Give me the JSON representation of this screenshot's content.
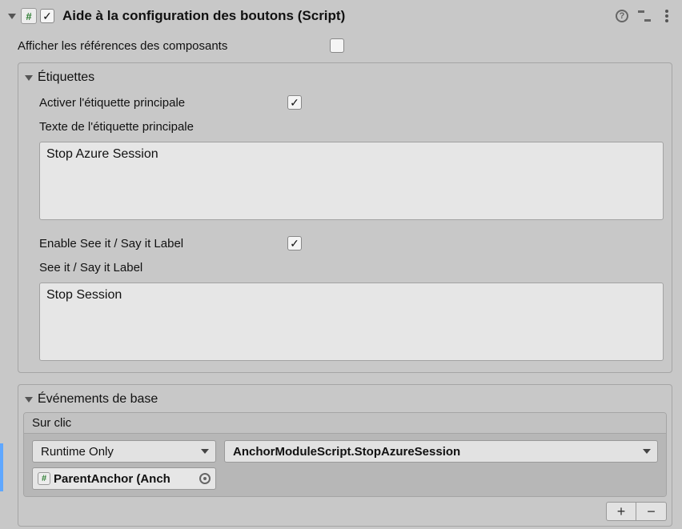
{
  "component": {
    "enabled": true,
    "title": "Aide à la configuration des boutons (Script)",
    "script_icon_char": "#"
  },
  "show_refs": {
    "label": "Afficher les références des composants",
    "checked": false
  },
  "labels_section": {
    "title": "Étiquettes",
    "main_label_enable": {
      "label": "Activer l'étiquette principale",
      "checked": true
    },
    "main_label_text": {
      "label": "Texte de l'étiquette principale",
      "value": "Stop Azure Session"
    },
    "seeit_enable": {
      "label": "Enable See it / Say it Label",
      "checked": true
    },
    "seeit_text": {
      "label": "See it / Say it Label",
      "value": "Stop Session"
    }
  },
  "events_section": {
    "title": "Événements de base",
    "on_click": {
      "header": "Sur clic",
      "runtime_dropdown": "Runtime Only",
      "method_dropdown": "AnchorModuleScript.StopAzureSession",
      "target_object": "ParentAnchor (Anch"
    },
    "buttons": {
      "plus": "+",
      "minus": "−"
    }
  }
}
